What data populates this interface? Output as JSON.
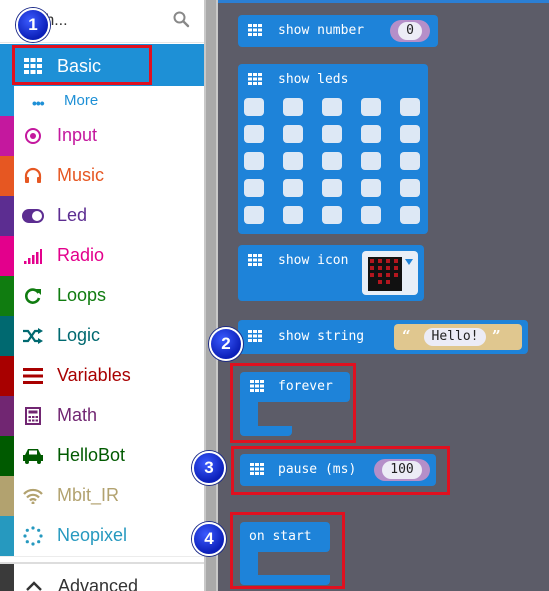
{
  "search": {
    "placeholder_visible": "rch..."
  },
  "categories": [
    {
      "key": "basic",
      "label": "Basic",
      "color": "#1e90d6",
      "icon": "grid-icon"
    },
    {
      "key": "more",
      "label": "More",
      "icon": "ellipsis-icon"
    },
    {
      "key": "input",
      "label": "Input",
      "color": "#c4189e",
      "icon": "radio-button-icon"
    },
    {
      "key": "music",
      "label": "Music",
      "color": "#e65722",
      "icon": "headphones-icon"
    },
    {
      "key": "led",
      "label": "Led",
      "color": "#5c2d91",
      "icon": "toggle-icon"
    },
    {
      "key": "radio",
      "label": "Radio",
      "color": "#e3008c",
      "icon": "signal-bars-icon"
    },
    {
      "key": "loops",
      "label": "Loops",
      "color": "#107c10",
      "icon": "refresh-icon"
    },
    {
      "key": "logic",
      "label": "Logic",
      "color": "#006970",
      "icon": "shuffle-icon"
    },
    {
      "key": "variables",
      "label": "Variables",
      "color": "#a80000",
      "icon": "list-lines-icon"
    },
    {
      "key": "math",
      "label": "Math",
      "color": "#712672",
      "icon": "calculator-icon"
    },
    {
      "key": "hellobot",
      "label": "HelloBot",
      "color": "#005a00",
      "icon": "car-icon"
    },
    {
      "key": "mbit_ir",
      "label": "Mbit_IR",
      "color": "#b2a26f",
      "icon": "wifi-icon"
    },
    {
      "key": "neopixel",
      "label": "Neopixel",
      "color": "#2699bf",
      "icon": "dotted-circle-icon"
    },
    {
      "key": "advanced",
      "label": "Advanced",
      "color": "#3a3a3a",
      "icon": "chevron-up-icon"
    }
  ],
  "blocks": {
    "show_number": {
      "label": "show number",
      "value": "0"
    },
    "show_leds": {
      "label": "show leds"
    },
    "show_icon": {
      "label": "show icon"
    },
    "show_string": {
      "label": "show string",
      "value": "Hello!"
    },
    "forever": {
      "label": "forever"
    },
    "pause": {
      "label": "pause (ms)",
      "value": "100"
    },
    "on_start": {
      "label": "on start"
    }
  },
  "badges": [
    "1",
    "2",
    "3",
    "4"
  ],
  "colors": {
    "highlight": "#e0101f",
    "block": "#1e83d9",
    "workspace": "#5c5c68",
    "badge": "#1b33d6"
  }
}
